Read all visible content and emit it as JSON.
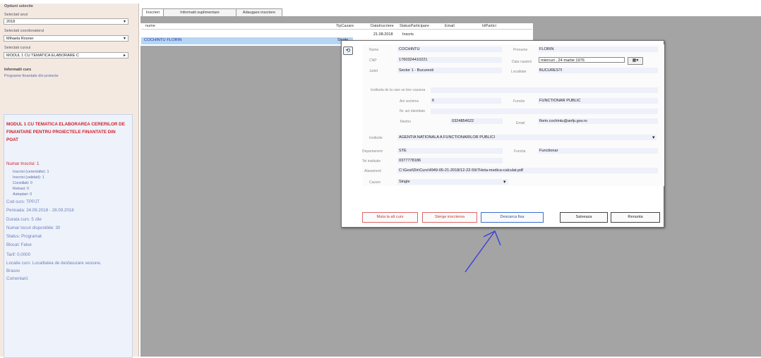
{
  "left_panel": {
    "header": "Optiuni selectie",
    "an_label": "Selectati anul",
    "an_value": "2018",
    "coord_label": "Selectati coordonatorul",
    "coord_value": "Mihaela Rosner",
    "curs_label": "Selectati cursul",
    "curs_value": "MODUL 1 CU TEMATICA ELABORARE C",
    "info_label": "Informatii curs",
    "program_link": "Programe finantate din proiecte",
    "course_title": "MODUL 1 CU TEMATICA ELABORAREA CERERILOR DE FINANTARE PENTRU PROIECTELE FINANTATE DIN POAT",
    "numar_inscrisi": "Numar Inscrisi: 1",
    "sub_items": [
      "Inscrisi (cereri/alte): 1",
      "Inscrisi (validati): 1",
      "Consiliati: 0",
      "Retrasi: 0",
      "Asteptari: 0"
    ],
    "info_items": [
      "Cod curs: TPPJT",
      "Perioada: 24.09.2018 - 28.09.2018",
      "Durata curs: 5 zile",
      "Numar locuri disponibile: 30",
      "Status: Programat",
      "Blocat: False",
      "Tarif: 0,0000",
      "Locatie curs: Localitatea de desfasurare sesiune, Brasov",
      "Comentarii:"
    ]
  },
  "tabs": [
    "Inscrieri",
    "Informatii suplimentare",
    "Adaugare inscriere"
  ],
  "grid": {
    "columns": [
      "nume",
      "TipCazare",
      "DataInscriere",
      "StatusParticipare",
      "Email",
      "IdPartici"
    ],
    "row": {
      "name": "COCHINTU FLORIN",
      "tip": "Single",
      "date": "21.08.2018",
      "status": "Inscris",
      "email": "florin.cochintu@anfp.gov.ro"
    }
  },
  "dialog": {
    "nume_label": "Nume",
    "nume_value": "COCHINTU",
    "prenume_label": "Prenume",
    "prenume_value": "FLORIN",
    "cnp_label": "CNP",
    "cnp_value": "1760324410221",
    "data_nasterii_label": "Data nasterii",
    "data_nasterii_value": "miercuri , 24   martie    1976",
    "judet_label": "Judet",
    "judet_value": "Sector 1 - Bucuresti",
    "localitate_label": "Localitate",
    "localitate_value": "BUCURESTI",
    "contact_label": "Institutia de la care se tine cazarea",
    "ani_label": "Ani vechime",
    "ani_value": "6",
    "functie_label": "Functie",
    "functie_value": "FUNCTIONAR PUBLIC",
    "nr_legit_label": "Nr. act identitate",
    "telefon_label": "Telefon",
    "telefon_value": "0324854622",
    "email_label": "Email",
    "email_value": "florin.cochintu@anfp.gov.ro",
    "institutie_label": "Institutie",
    "institutie_value": "AGENTIA NATIONALA A FUNCTIONARILOR PUBLICI",
    "departament_label": "Departament",
    "departament_value": "STE",
    "functia_label": "Functia",
    "functia_value": "Functionar",
    "telefon2_label": "Tel institutie",
    "telefon2_value": "0377778186",
    "atasament_label": "Atasament",
    "atasament_value": "C:\\Gest\\Dir\\Curs\\4949-05-21-2018/12-22-59/7Hota-medica-calculat.pdf",
    "cazare_label": "Cazare",
    "cazare_value": "Single",
    "btn_other": "Muta la alt curs",
    "btn_delete": "Sterge inscrierea",
    "btn_download": "Descarca fisa",
    "btn_save": "Salveaza",
    "btn_cancel": "Renunta"
  },
  "colors": {
    "accent_red": "#d2202a",
    "selection": "#b7d5f4",
    "arrow": "#3b3fd8"
  }
}
